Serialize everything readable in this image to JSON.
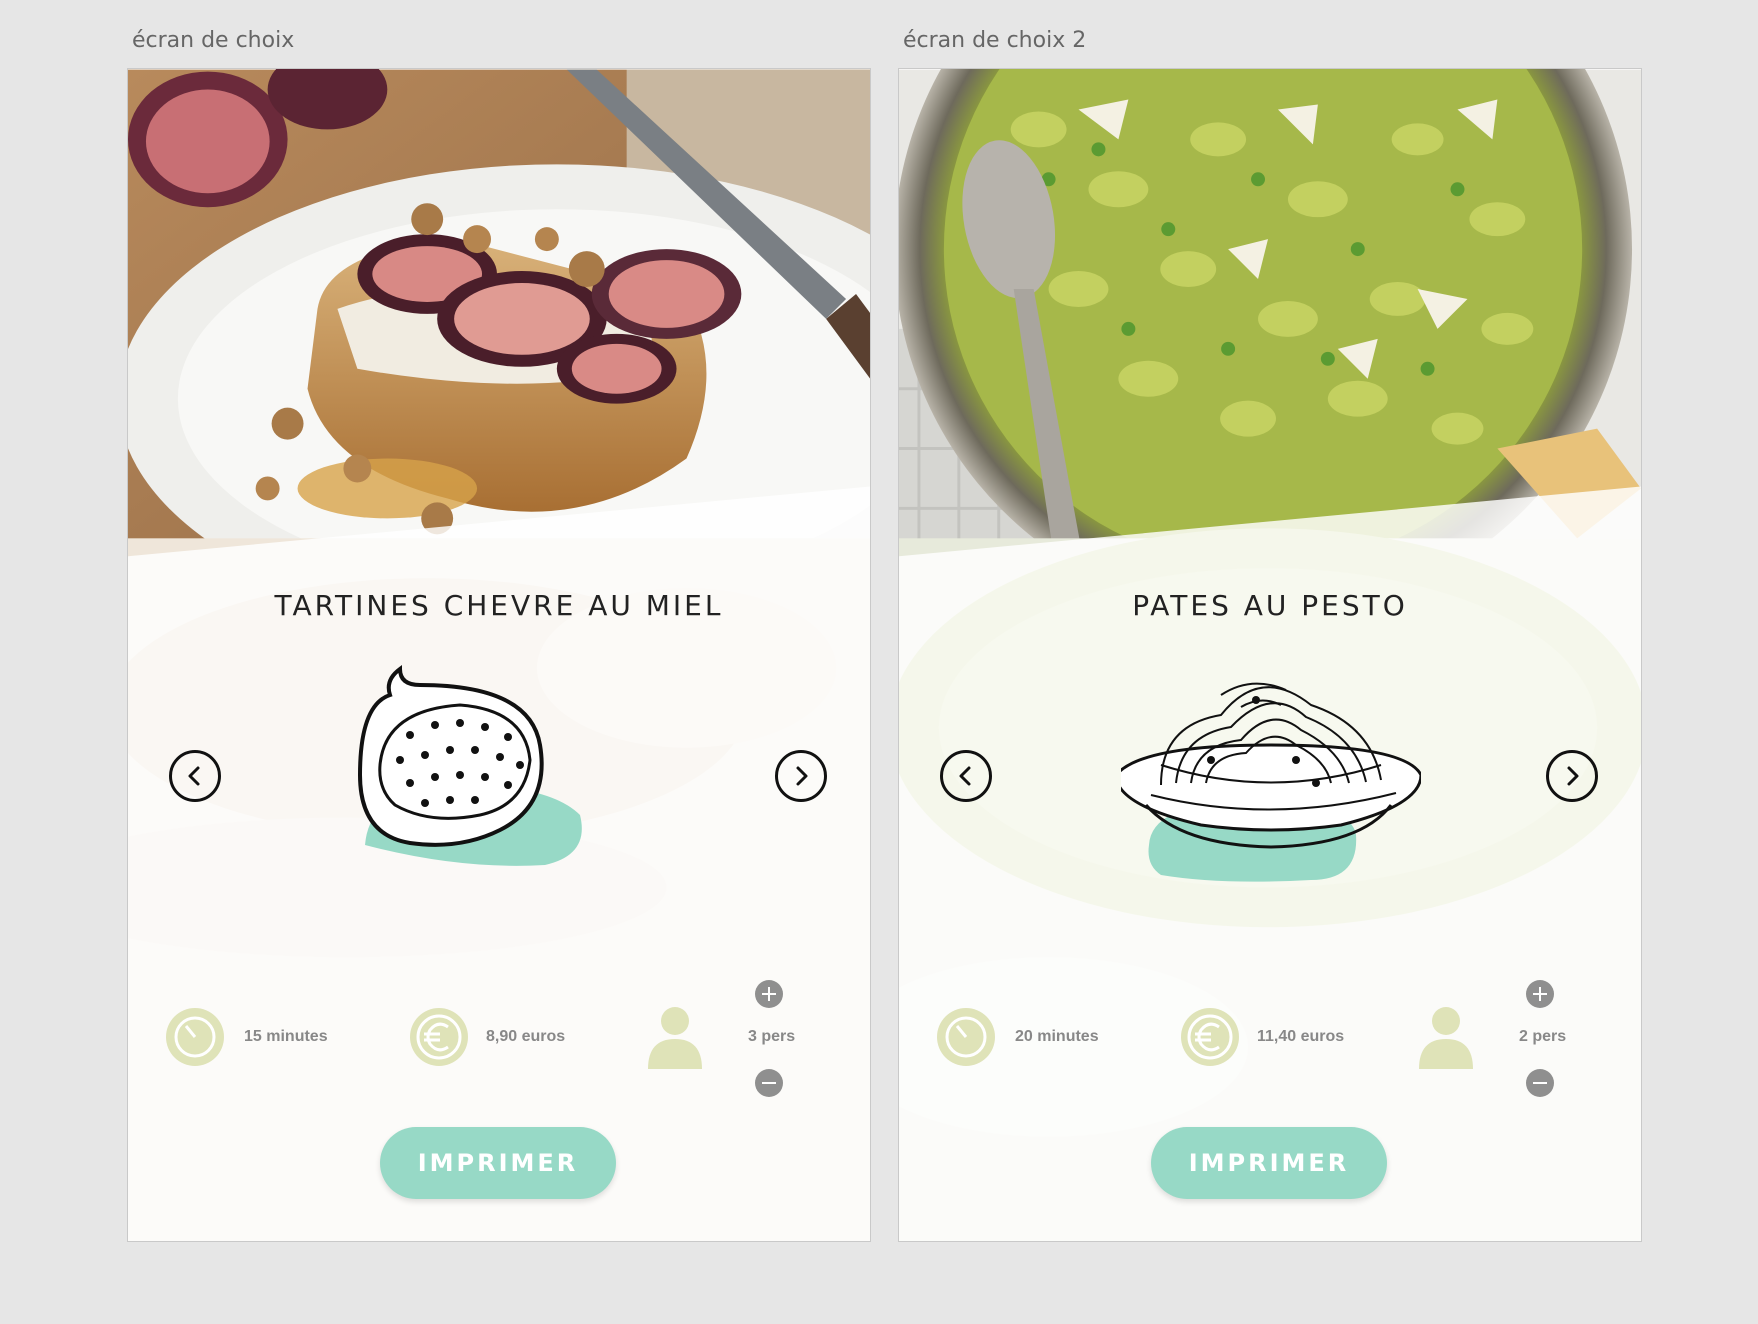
{
  "artboards": [
    {
      "label": "écran de choix",
      "recipe_title": "TARTINES CHEVRE AU MIEL",
      "photo_name": "fig-goat-cheese-toast-photo",
      "illustration_name": "fig-illustration",
      "time": "15 minutes",
      "price": "8,90 euros",
      "persons": "3 pers",
      "print_label": "IMPRIMER"
    },
    {
      "label": "écran de choix 2",
      "recipe_title": "PATES AU PESTO",
      "photo_name": "pesto-pasta-photo",
      "illustration_name": "pasta-plate-illustration",
      "time": "20 minutes",
      "price": "11,40 euros",
      "persons": "2 pers",
      "print_label": "IMPRIMER"
    }
  ],
  "colors": {
    "accent": "#97d9c6",
    "icon_tint": "#dfe3b8",
    "stepper": "#8f8f8f",
    "background": "#e6e6e6"
  },
  "icons": [
    "clock-icon",
    "euro-icon",
    "person-icon",
    "plus-icon",
    "minus-icon",
    "chevron-left-icon",
    "chevron-right-icon"
  ]
}
